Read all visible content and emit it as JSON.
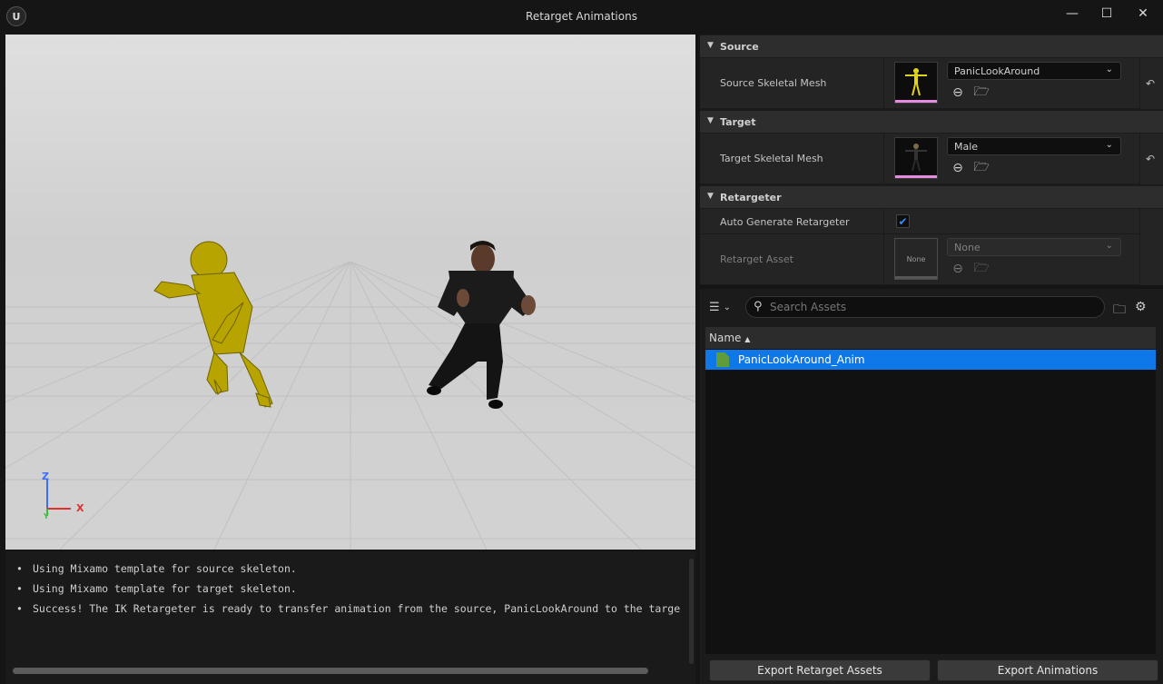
{
  "window": {
    "title": "Retarget Animations",
    "logo_text": "U",
    "minimize_glyph": "—",
    "maximize_glyph": "☐",
    "close_glyph": "✕"
  },
  "viewport": {
    "axis": {
      "z": "Z",
      "x": "X",
      "y": "Y"
    }
  },
  "log": {
    "lines": [
      "Using Mixamo template for source skeleton.",
      "Using Mixamo template for target skeleton.",
      "Success! The IK Retargeter is ready to transfer animation from the source, PanicLookAround to the targe"
    ],
    "bullet": "•"
  },
  "details": {
    "source": {
      "category": "Source",
      "label": "Source Skeletal Mesh",
      "value": "PanicLookAround"
    },
    "target": {
      "category": "Target",
      "label": "Target Skeletal Mesh",
      "value": "Male"
    },
    "retargeter": {
      "category": "Retargeter",
      "auto_label": "Auto Generate Retargeter",
      "auto_checked": true,
      "asset_label": "Retarget Asset",
      "asset_value": "None",
      "asset_thumb_text": "None"
    }
  },
  "assets": {
    "search_placeholder": "Search Assets",
    "column_name": "Name",
    "sort_glyph": "▲",
    "items": [
      "PanicLookAround_Anim"
    ],
    "export_retarget_label": "Export Retarget Assets",
    "export_animations_label": "Export Animations"
  },
  "colors": {
    "accent": "#0e78e8",
    "thumb_bar": "#e58be0",
    "checkbox": "#2f8fff",
    "anim_asset": "#5f9c3a"
  }
}
